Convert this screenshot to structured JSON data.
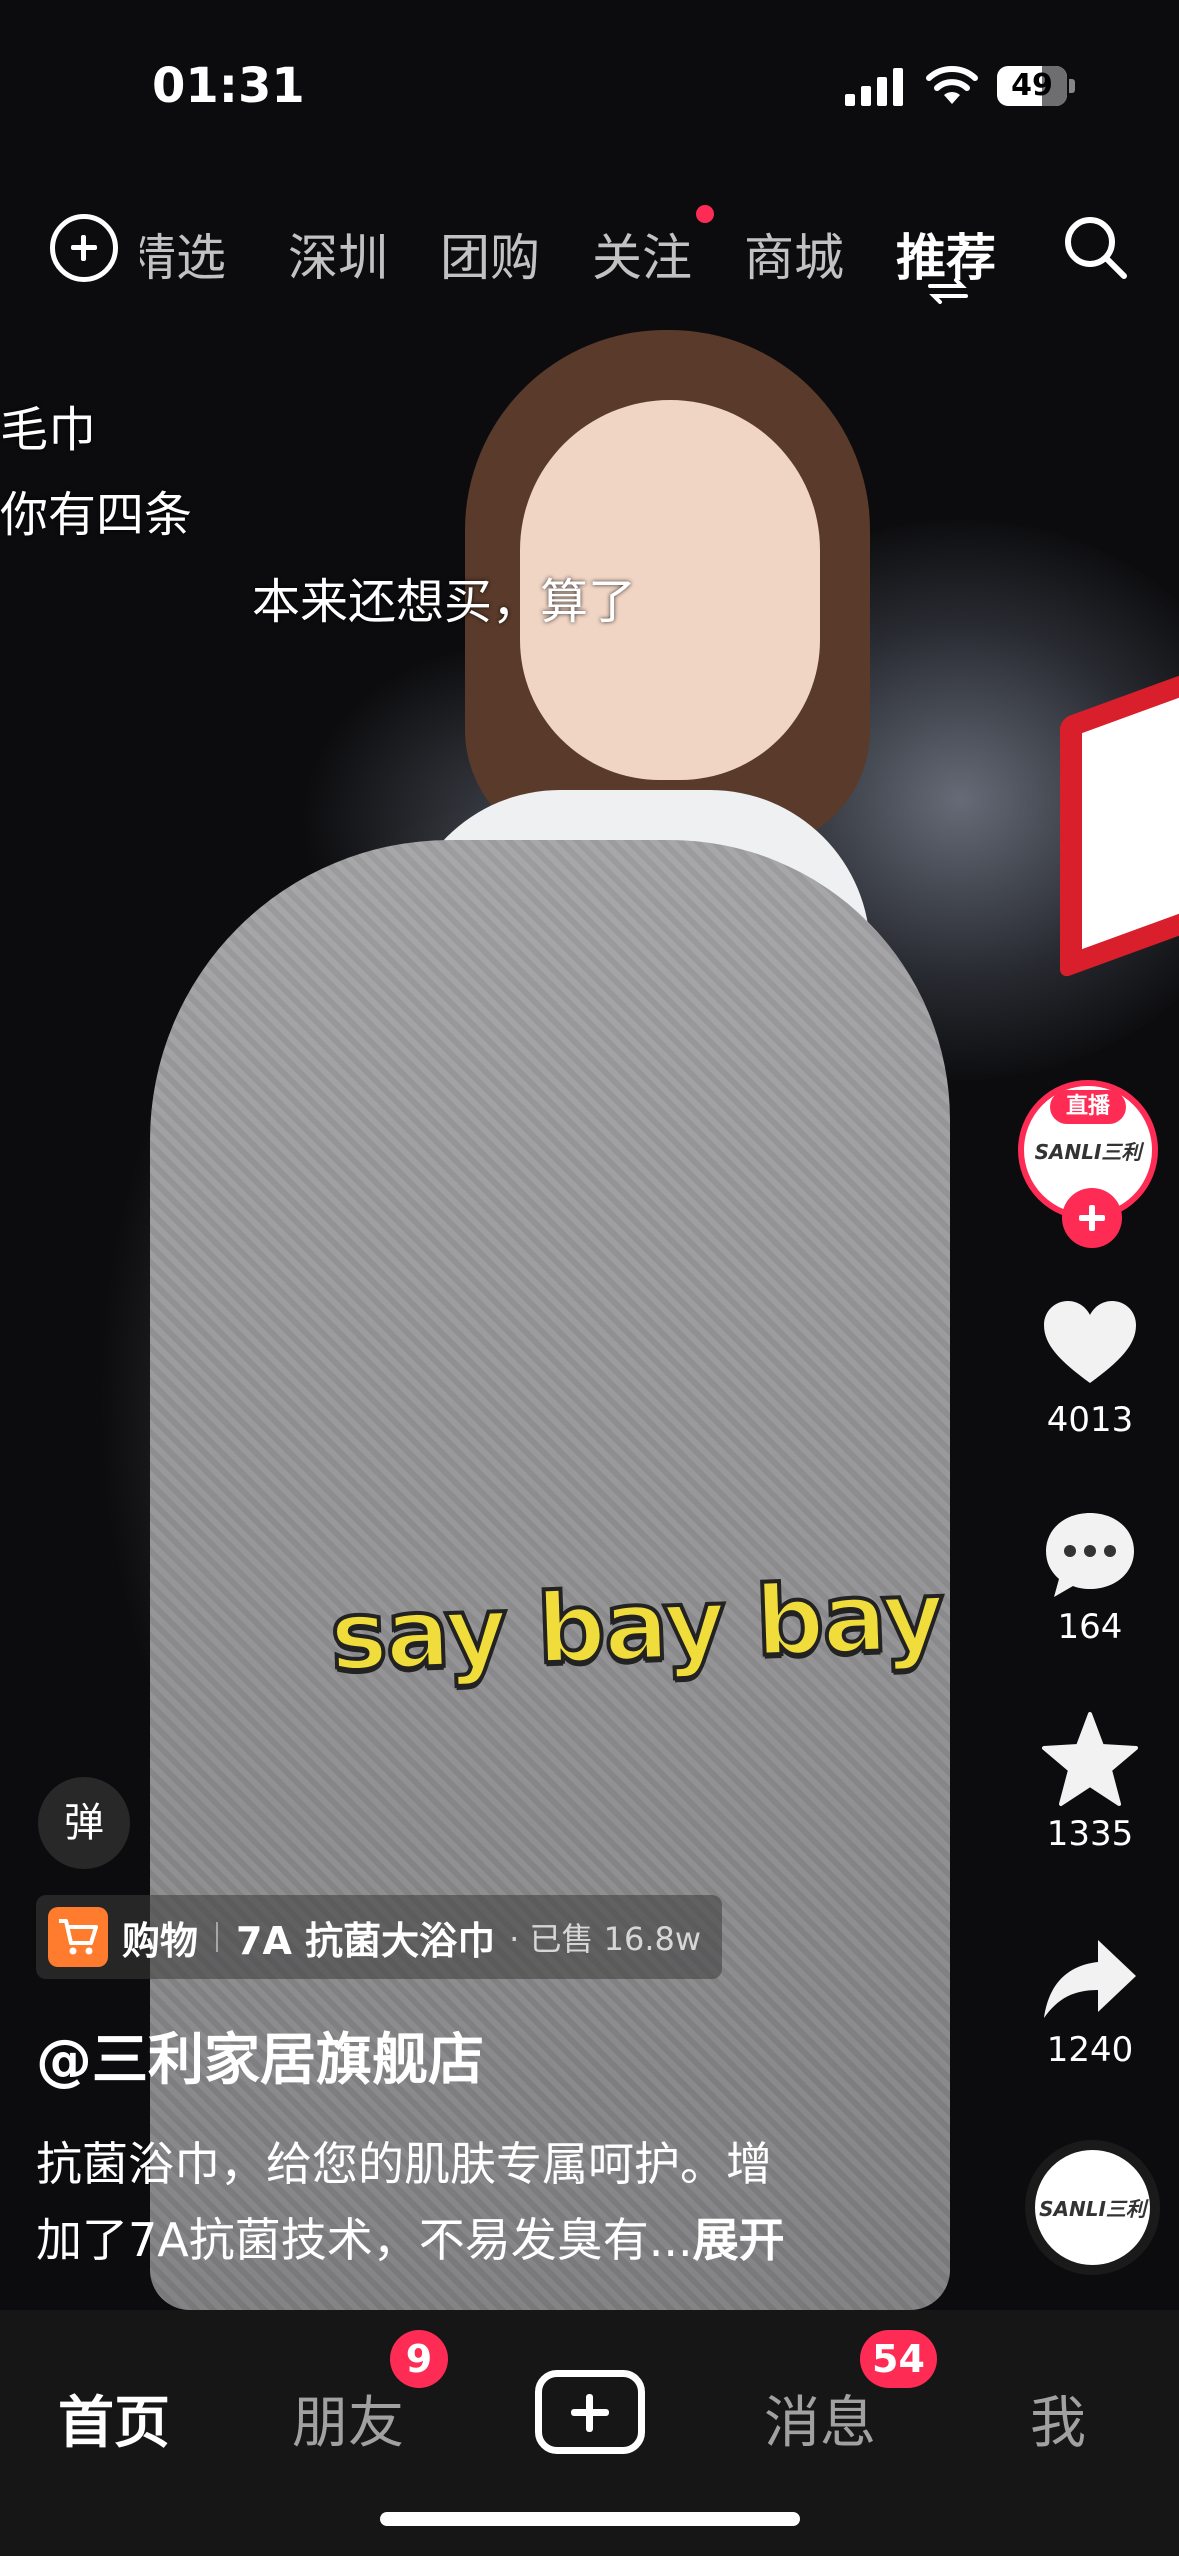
{
  "status_bar": {
    "time": "01:31",
    "battery": "49"
  },
  "top_tabs": [
    {
      "label": "精选"
    },
    {
      "label": "深圳"
    },
    {
      "label": "团购"
    },
    {
      "label": "关注"
    },
    {
      "label": "商城"
    },
    {
      "label": "推荐",
      "active": true
    }
  ],
  "danmaku": [
    "毛巾",
    "你有四条",
    "本来还想买，算了"
  ],
  "caption": "say bay bay",
  "sidebar": {
    "live_label": "直播",
    "avatar_text": "SANLI三利",
    "likes": "4013",
    "comments": "164",
    "favorites": "1335",
    "shares": "1240",
    "disc_text": "SANLI三利"
  },
  "video_info": {
    "danmu_toggle": "弹",
    "shop": {
      "label": "购物",
      "product": "7A 抗菌大浴巾",
      "sold": "· 已售 16.8w"
    },
    "author": "@三利家居旗舰店",
    "desc_line1": "抗菌浴巾，给您的肌肤专属呵护。增",
    "desc_line2": "加了7A抗菌技术，不易发臭有...",
    "expand": "展开"
  },
  "tabbar": {
    "home": "首页",
    "friends": "朋友",
    "friends_badge": "9",
    "messages": "消息",
    "messages_badge": "54",
    "me": "我"
  },
  "colors": {
    "accent": "#fe2c55",
    "cart": "#ff7b2e",
    "caption": "#f0dc3a"
  }
}
